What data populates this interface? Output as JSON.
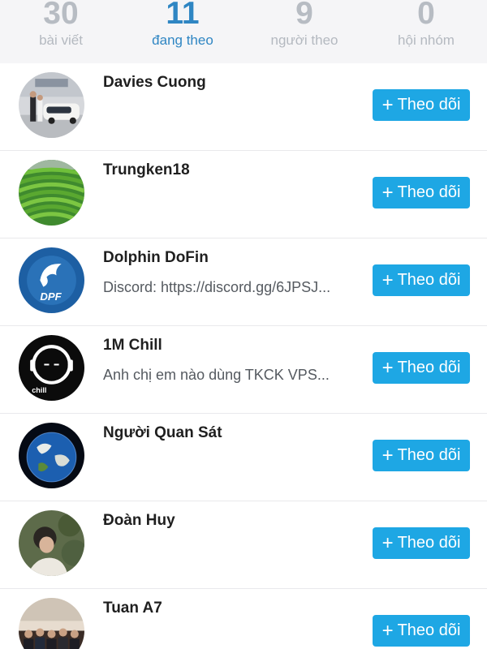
{
  "stats": [
    {
      "count": "30",
      "label": "bài viết",
      "active": false
    },
    {
      "count": "11",
      "label": "đang theo",
      "active": true
    },
    {
      "count": "9",
      "label": "người theo",
      "active": false
    },
    {
      "count": "0",
      "label": "hội nhóm",
      "active": false
    }
  ],
  "follow_label": "Theo dõi",
  "follow_icon": "plus-icon",
  "colors": {
    "accent": "#2f86c3",
    "follow_button": "#1ea7e4",
    "stat_inactive": "#b7bcc3",
    "stats_background": "#f5f5f7"
  },
  "users": [
    {
      "name": "Davies Cuong",
      "status": ""
    },
    {
      "name": "Trungken18",
      "status": ""
    },
    {
      "name": "Dolphin DoFin",
      "status": "Discord: https://discord.gg/6JPSJ..."
    },
    {
      "name": "1M Chill",
      "status": "Anh chị em nào dùng TKCK VPS..."
    },
    {
      "name": "Người Quan Sát",
      "status": ""
    },
    {
      "name": "Đoàn Huy",
      "status": ""
    },
    {
      "name": "Tuan A7",
      "status": ""
    }
  ],
  "avatar_logos": {
    "dolphin": "DPF",
    "chill": "chill"
  }
}
